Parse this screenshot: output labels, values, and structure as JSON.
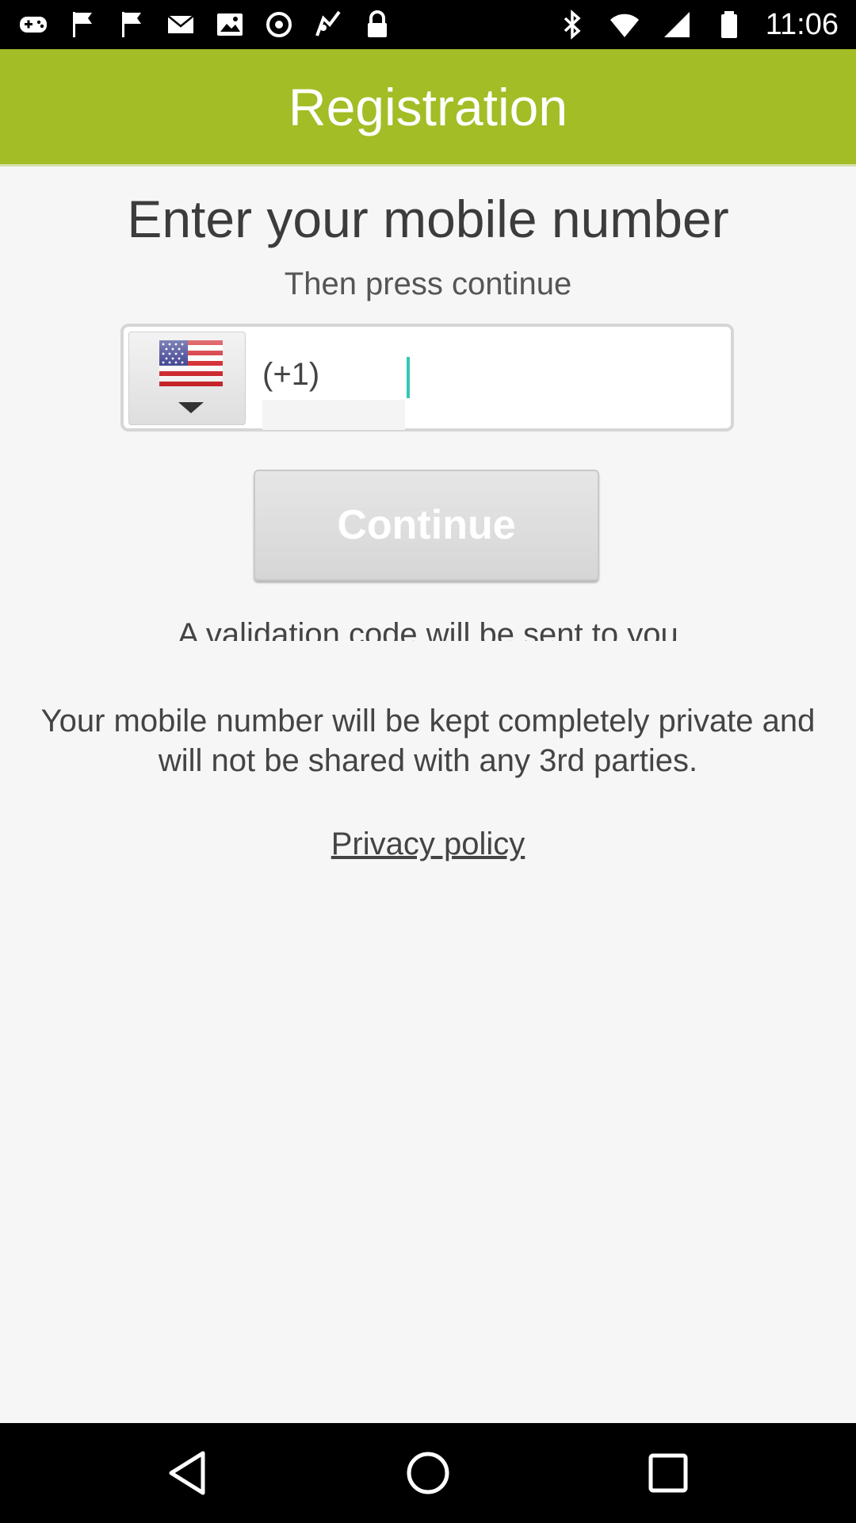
{
  "status_bar": {
    "time": "11:06",
    "left_icons": [
      "gamepad-icon",
      "flag-icon",
      "flag-icon",
      "email-icon",
      "photo-icon",
      "sync-icon",
      "location-icon",
      "lock-icon"
    ],
    "right_icons": [
      "bluetooth-icon",
      "wifi-icon",
      "signal-icon",
      "battery-icon"
    ]
  },
  "header": {
    "title": "Registration"
  },
  "main": {
    "heading": "Enter your mobile number",
    "subheading": "Then press continue",
    "phone": {
      "country_flag": "us-flag-icon",
      "country_code": "(+1)",
      "value": "",
      "placeholder": ""
    },
    "continue_label": "Continue",
    "validation_note": "A validation code will be sent to you",
    "privacy_note": "Your mobile number will be kept completely private and will not be shared with any 3rd parties.",
    "privacy_link": "Privacy policy"
  },
  "nav_bar": {
    "buttons": [
      "back-icon",
      "home-icon",
      "recents-icon"
    ]
  },
  "colors": {
    "header_bg": "#a2bd25",
    "page_bg": "#f6f6f6",
    "cursor": "#35c6b5"
  }
}
